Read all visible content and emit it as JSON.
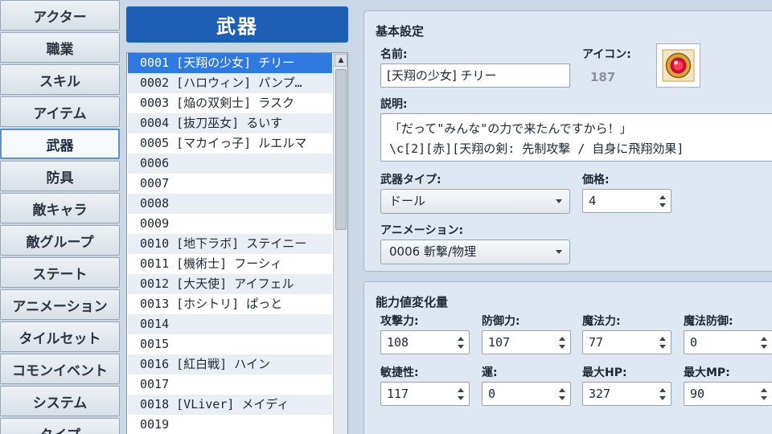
{
  "sidebar": {
    "items": [
      {
        "label": "アクター"
      },
      {
        "label": "職業"
      },
      {
        "label": "スキル"
      },
      {
        "label": "アイテム"
      },
      {
        "label": "武器"
      },
      {
        "label": "防具"
      },
      {
        "label": "敵キャラ"
      },
      {
        "label": "敵グループ"
      },
      {
        "label": "ステート"
      },
      {
        "label": "アニメーション"
      },
      {
        "label": "タイルセット"
      },
      {
        "label": "コモンイベント"
      },
      {
        "label": "システム"
      },
      {
        "label": "タイプ"
      }
    ],
    "active_index": 4
  },
  "list": {
    "title": "武器",
    "selected_index": 0,
    "rows": [
      {
        "text": "0001 [天翔の少女] チリー"
      },
      {
        "text": "0002 [ハロウィン] パンプ…"
      },
      {
        "text": "0003 [焔の双剣士] ラスク"
      },
      {
        "text": "0004 [抜刀巫女] るいす"
      },
      {
        "text": "0005 [マカイっ子] ルエルマ"
      },
      {
        "text": "0006"
      },
      {
        "text": "0007"
      },
      {
        "text": "0008"
      },
      {
        "text": "0009"
      },
      {
        "text": "0010 [地下ラボ] ステイニー"
      },
      {
        "text": "0011 [機術士] フーシィ"
      },
      {
        "text": "0012 [大天使] アイフェル"
      },
      {
        "text": "0013 [ホシトリ] ぱっと"
      },
      {
        "text": "0014"
      },
      {
        "text": "0015"
      },
      {
        "text": "0016 [紅白戦] ハイン"
      },
      {
        "text": "0017"
      },
      {
        "text": "0018 [VLiver] メイディ"
      },
      {
        "text": "0019"
      }
    ]
  },
  "basic": {
    "title": "基本設定",
    "name_label": "名前:",
    "name_value": "[天翔の少女] チリー",
    "icon_label": "アイコン:",
    "icon_index": "187",
    "icon_name": "red-orb-icon",
    "desc_label": "説明:",
    "desc_lines": [
      "「だって\"みんな\"の力で来たんですから！」",
      "\\c[2][赤][天翔の剣: 先制攻撃 / 自身に飛翔効果]"
    ],
    "wtype_label": "武器タイプ:",
    "wtype_value": "ドール",
    "price_label": "価格:",
    "price_value": "4",
    "anim_label": "アニメーション:",
    "anim_value": "0006 斬撃/物理"
  },
  "params": {
    "title": "能力値変化量",
    "items": [
      {
        "label": "攻撃力:",
        "value": "108"
      },
      {
        "label": "防御力:",
        "value": "107"
      },
      {
        "label": "魔法力:",
        "value": "77"
      },
      {
        "label": "魔法防御:",
        "value": "0"
      },
      {
        "label": "敏捷性:",
        "value": "117"
      },
      {
        "label": "運:",
        "value": "0"
      },
      {
        "label": "最大HP:",
        "value": "327"
      },
      {
        "label": "最大MP:",
        "value": "90"
      }
    ]
  },
  "colors": {
    "header_blue": "#1c5fb4",
    "selection_blue": "#2f7ae0",
    "panel_bg": "#dfe8f2",
    "window_bg": "#c9d7e6"
  }
}
